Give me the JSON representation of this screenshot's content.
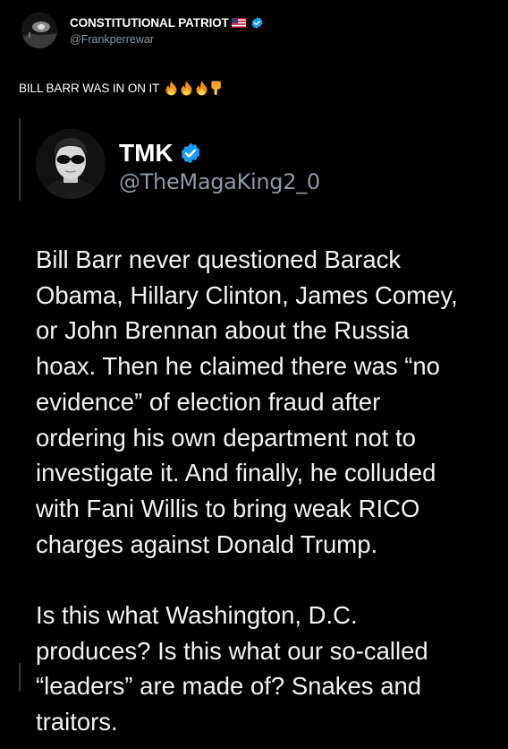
{
  "post": {
    "author": {
      "display_name": "CONSTITUTIONAL PATRIOT",
      "flag_icon": "us-flag-icon",
      "verified_icon": "verified-badge-icon",
      "handle": "@Frankperrewar"
    },
    "text": "BILL BARR WAS IN ON IT",
    "emojis": [
      "fire-icon",
      "fire-icon",
      "fire-icon",
      "pointing-down-icon"
    ]
  },
  "embedded_post": {
    "author": {
      "display_name": "TMK",
      "verified_icon": "verified-badge-icon",
      "handle": "@TheMagaKing2_0"
    },
    "paragraphs": [
      {
        "lines": [
          "Bill Barr never questioned Barack",
          "Obama, Hillary Clinton, James Comey,",
          "or John Brennan about the Russia",
          "hoax. Then he claimed there was “no",
          "evidence” of election fraud after",
          "ordering his own department not to",
          "investigate it. And finally, he colluded",
          "with Fani Willis to bring weak RICO",
          "charges against Donald Trump."
        ]
      },
      {
        "lines": [
          "Is this what Washington, D.C.",
          "produces? Is this what our so-called",
          "“leaders” are made of? Snakes and",
          "traitors."
        ]
      }
    ]
  },
  "colors": {
    "background": "#000000",
    "text": "#ffffff",
    "secondary_text": "#8b98a5",
    "verified_blue": "#1d9bf0"
  }
}
